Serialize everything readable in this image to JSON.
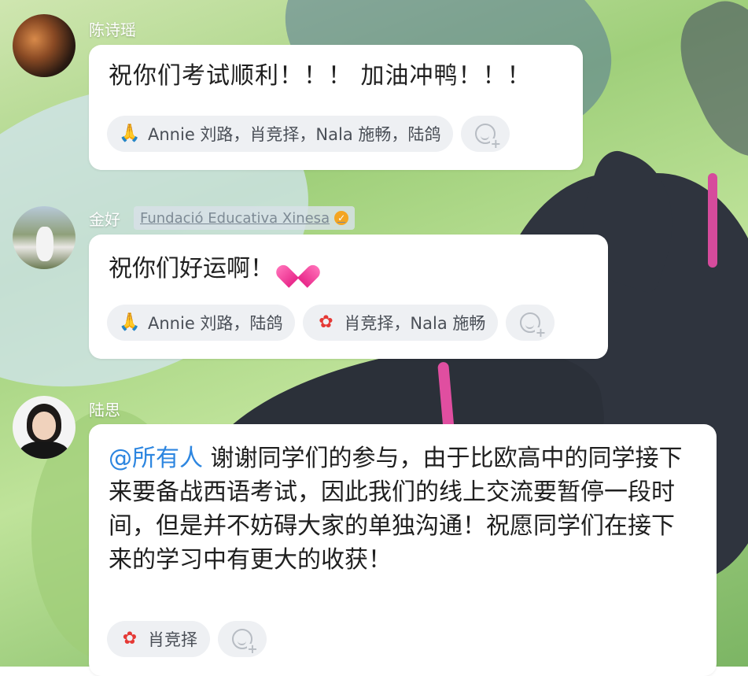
{
  "messages": [
    {
      "sender": "陈诗瑶",
      "text": "祝你们考试顺利！！！ 加油冲鸭！！！",
      "reactions": [
        {
          "emoji": "pray-icon",
          "users": "Annie 刘路，肖竞择，Nala 施畅，陆鸽"
        }
      ]
    },
    {
      "sender": "金好",
      "org_tag": "Fundació Educativa Xinesa",
      "text": "祝你们好运啊！",
      "emoji": "sparkling-heart-icon",
      "reactions": [
        {
          "emoji": "pray-icon",
          "users": "Annie 刘路，陆鸽"
        },
        {
          "emoji": "flower-icon",
          "users": "肖竞择，Nala 施畅"
        }
      ]
    },
    {
      "sender": "陆思",
      "mention": "@所有人",
      "text": "谢谢同学们的参与，由于比欧高中的同学接下来要备战西语考试，因此我们的线上交流要暂停一段时间，但是并不妨碍大家的单独沟通！祝愿同学们在接下来的学习中有更大的收获！",
      "reactions": [
        {
          "emoji": "flower-icon",
          "users": "肖竞择"
        }
      ]
    }
  ],
  "colors": {
    "mention": "#2d86e0",
    "verified_badge": "#f4a521",
    "reaction_bg": "#eef0f3"
  }
}
